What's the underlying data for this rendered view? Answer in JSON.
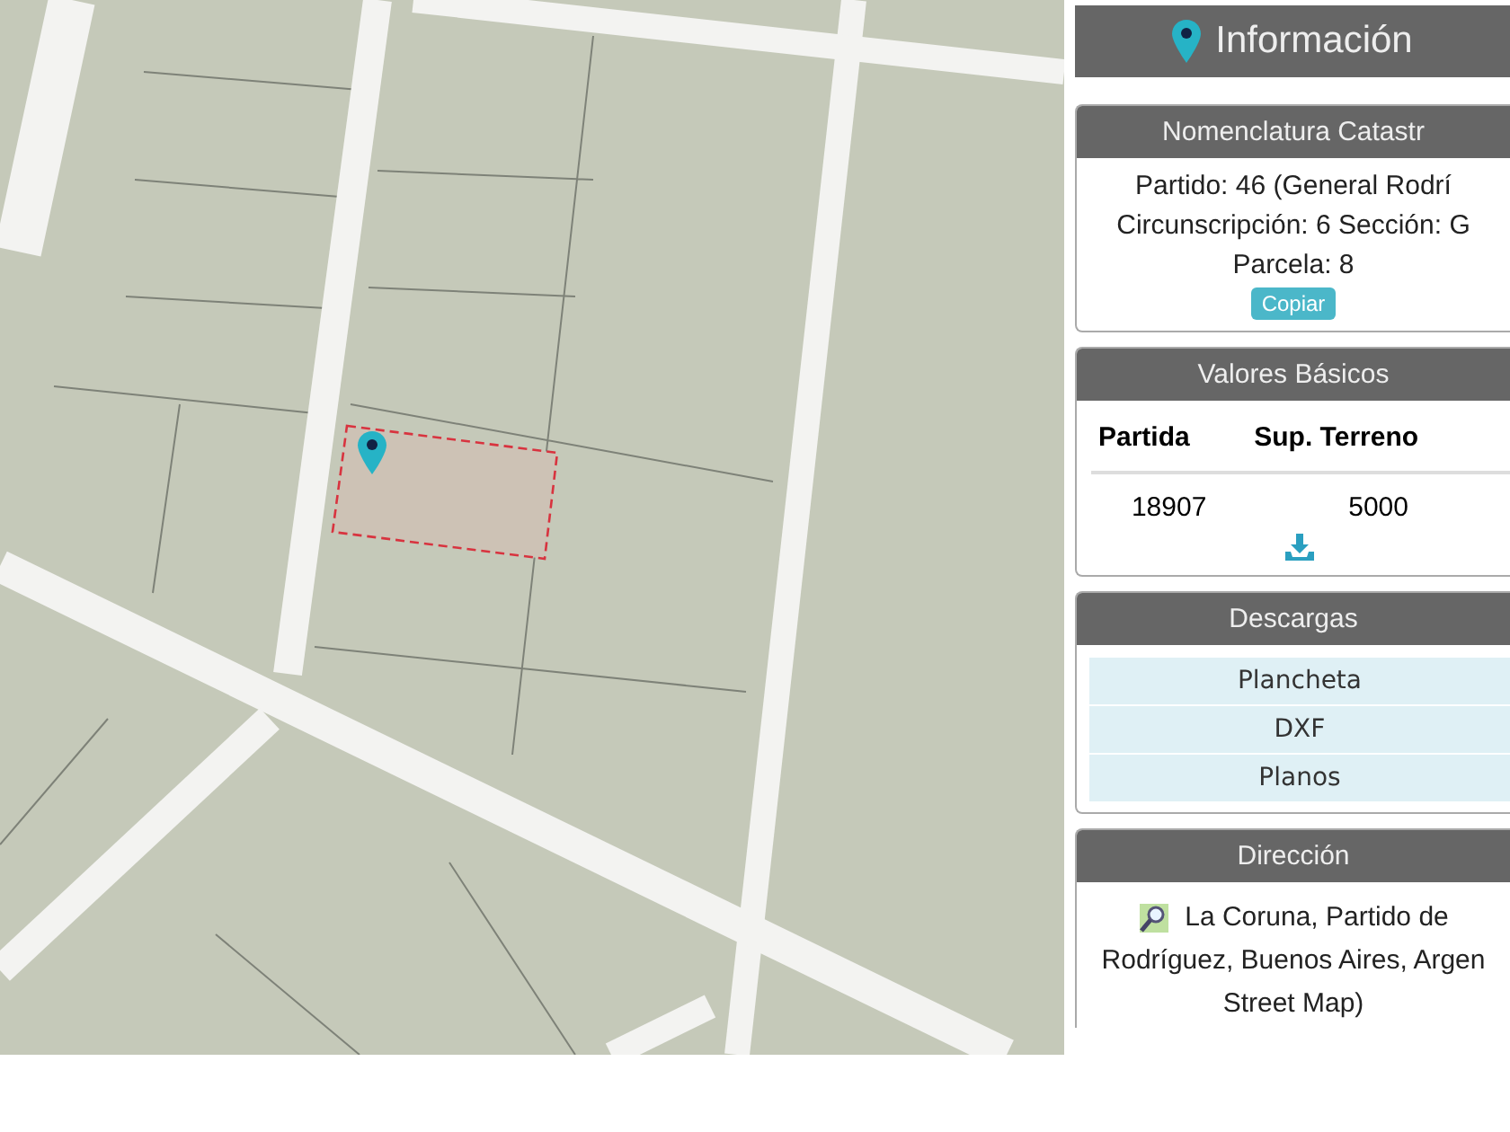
{
  "panel_title": "Información",
  "nomenclatura": {
    "title": "Nomenclatura Catastr",
    "lines": [
      "Partido: 46 (General Rodrí",
      "Circunscripción: 6 Sección: G",
      "Parcela: 8"
    ],
    "copy_button": "Copiar"
  },
  "valores_basicos": {
    "title": "Valores Básicos",
    "columns": [
      "Partida",
      "Sup. Terreno"
    ],
    "rows": [
      [
        "18907",
        "5000"
      ]
    ]
  },
  "descargas": {
    "title": "Descargas",
    "items": [
      "Plancheta",
      "DXF",
      "Planos"
    ]
  },
  "direccion": {
    "title": "Dirección",
    "lines": [
      "La Coruna, Partido de",
      "Rodríguez, Buenos Aires, Argen",
      "Street Map)"
    ]
  }
}
